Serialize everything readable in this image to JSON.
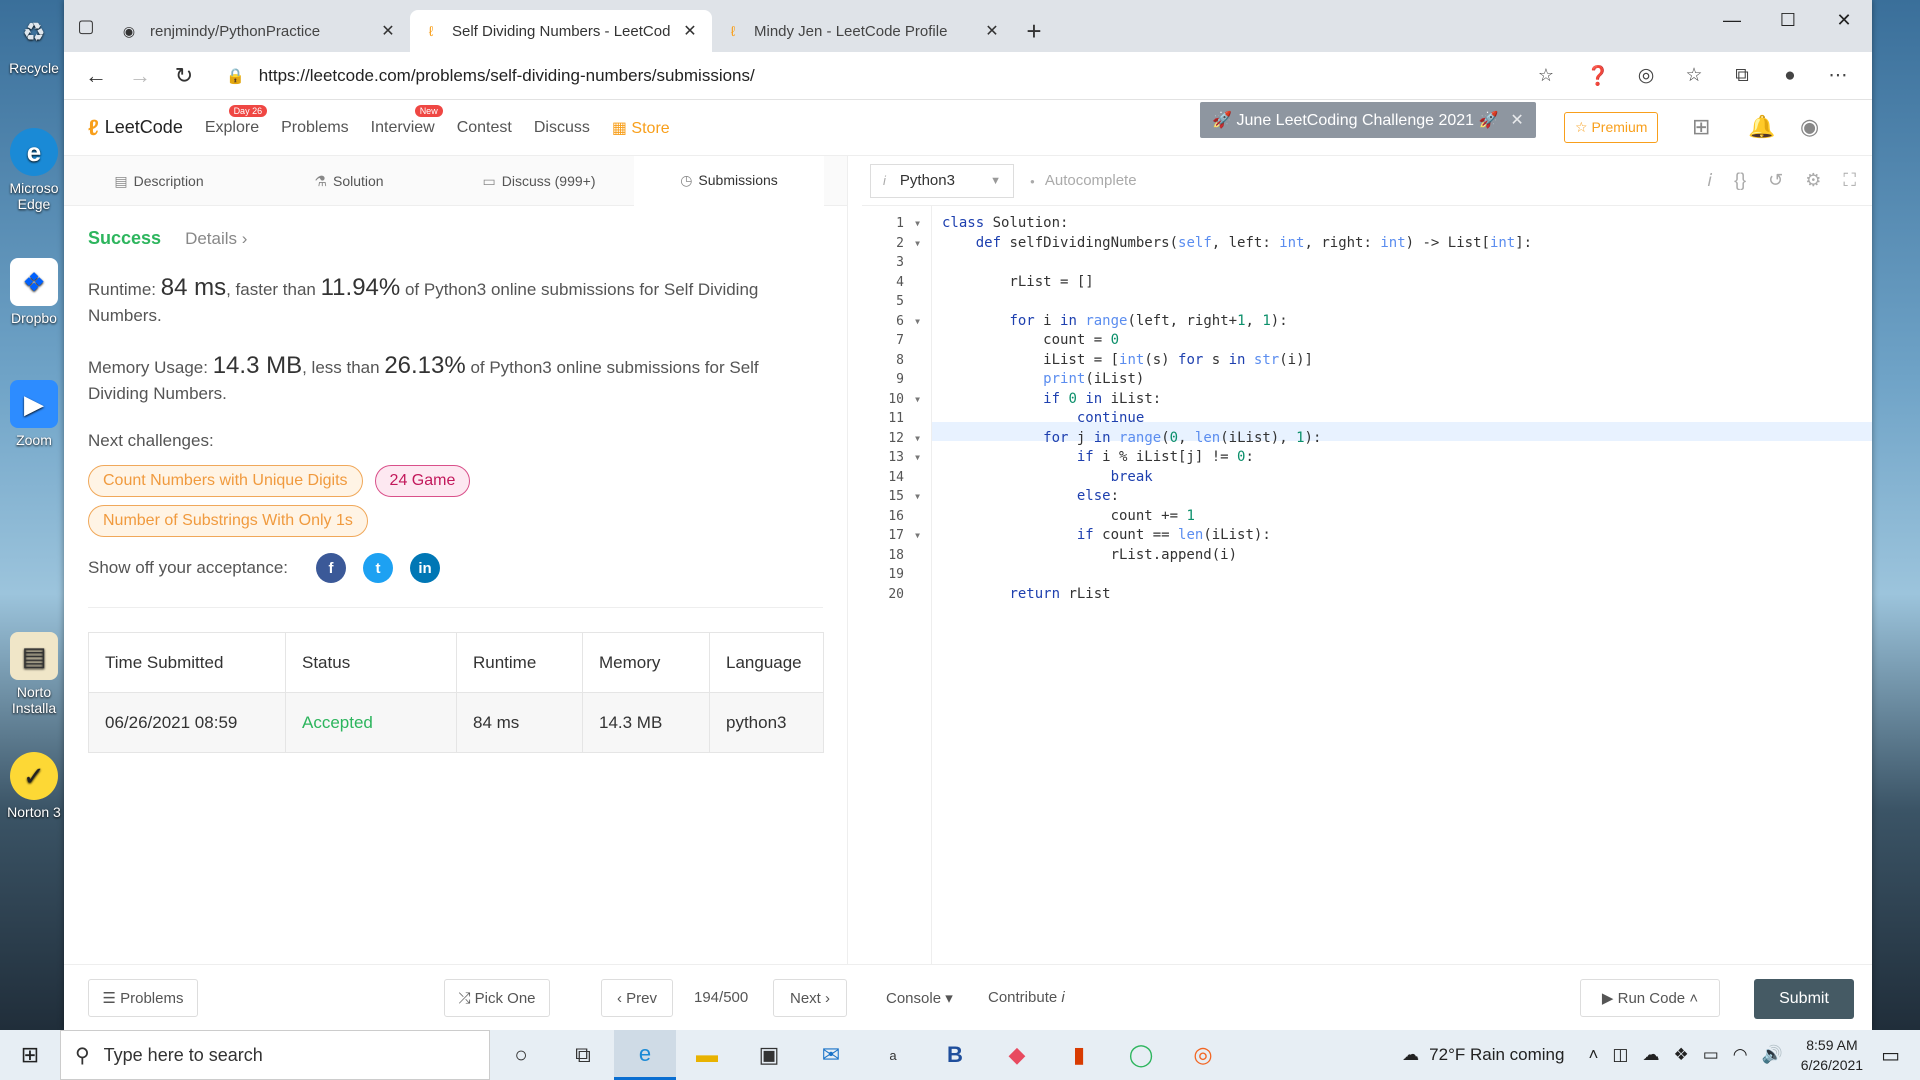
{
  "desktop": {
    "icons": [
      {
        "label": "Recycle"
      },
      {
        "label": "Microso Edge"
      },
      {
        "label": "Dropbo"
      },
      {
        "label": "Zoom"
      },
      {
        "label": "Norto Installa"
      },
      {
        "label": "Norton 3"
      }
    ]
  },
  "browser": {
    "tabs": [
      {
        "label": "renjmindy/PythonPractice"
      },
      {
        "label": "Self Dividing Numbers - LeetCod"
      },
      {
        "label": "Mindy Jen - LeetCode Profile"
      }
    ],
    "url": "https://leetcode.com/problems/self-dividing-numbers/submissions/"
  },
  "lcnav": {
    "logo": "LeetCode",
    "links": {
      "explore": "Explore",
      "explore_badge": "Day 26",
      "problems": "Problems",
      "interview": "Interview",
      "interview_badge": "New",
      "contest": "Contest",
      "discuss": "Discuss",
      "store": "Store"
    },
    "challenge": "🚀 June LeetCoding Challenge 2021 🚀",
    "premium": "☆ Premium"
  },
  "subtabs": {
    "description": "Description",
    "solution": "Solution",
    "discuss": "Discuss (999+)",
    "submissions": "Submissions"
  },
  "result": {
    "status": "Success",
    "details": "Details ›",
    "runtime_label": "Runtime: ",
    "runtime_value": "84 ms",
    "runtime_mid": ", faster than ",
    "runtime_pct": "11.94%",
    "runtime_tail": " of Python3 online submissions for Self Dividing Numbers.",
    "memory_label": "Memory Usage: ",
    "memory_value": "14.3 MB",
    "memory_mid": ", less than ",
    "memory_pct": "26.13%",
    "memory_tail": " of Python3 online submissions for Self Dividing Numbers.",
    "next_label": "Next challenges:",
    "next": {
      "c1": "Count Numbers with Unique Digits",
      "c2": "24 Game",
      "c3": "Number of Substrings With Only 1s"
    },
    "share_label": "Show off your acceptance:"
  },
  "table": {
    "headers": {
      "time": "Time Submitted",
      "status": "Status",
      "runtime": "Runtime",
      "memory": "Memory",
      "language": "Language"
    },
    "row": {
      "time": "06/26/2021 08:59",
      "status": "Accepted",
      "runtime": "84 ms",
      "memory": "14.3 MB",
      "language": "python3"
    }
  },
  "editor": {
    "language": "Python3",
    "autocomplete": "Autocomplete",
    "lines": [
      "class Solution:",
      "    def selfDividingNumbers(self, left: int, right: int) -> List[int]:",
      "",
      "        rList = []",
      "",
      "        for i in range(left, right+1, 1):",
      "            count = 0",
      "            iList = [int(s) for s in str(i)]",
      "            print(iList)",
      "            if 0 in iList:",
      "                continue",
      "            for j in range(0, len(iList), 1):",
      "                if i % iList[j] != 0:",
      "                    break",
      "                else:",
      "                    count += 1",
      "                if count == len(iList):",
      "                    rList.append(i)",
      "",
      "        return rList"
    ],
    "folds": [
      1,
      2,
      6,
      10,
      12,
      13,
      15,
      17
    ]
  },
  "bottom": {
    "problems": "☰ Problems",
    "pick_one": "⤮ Pick One",
    "prev": "‹  Prev",
    "progress": "194/500",
    "next": "Next  ›",
    "console": "Console ▾",
    "contribute": "Contribute",
    "contribute_i": "i",
    "run_code": "▶ Run Code ˄",
    "submit": "Submit"
  },
  "taskbar": {
    "search": "Type here to search",
    "weather": "72°F  Rain coming",
    "time": "8:59 AM",
    "date": "6/26/2021"
  }
}
